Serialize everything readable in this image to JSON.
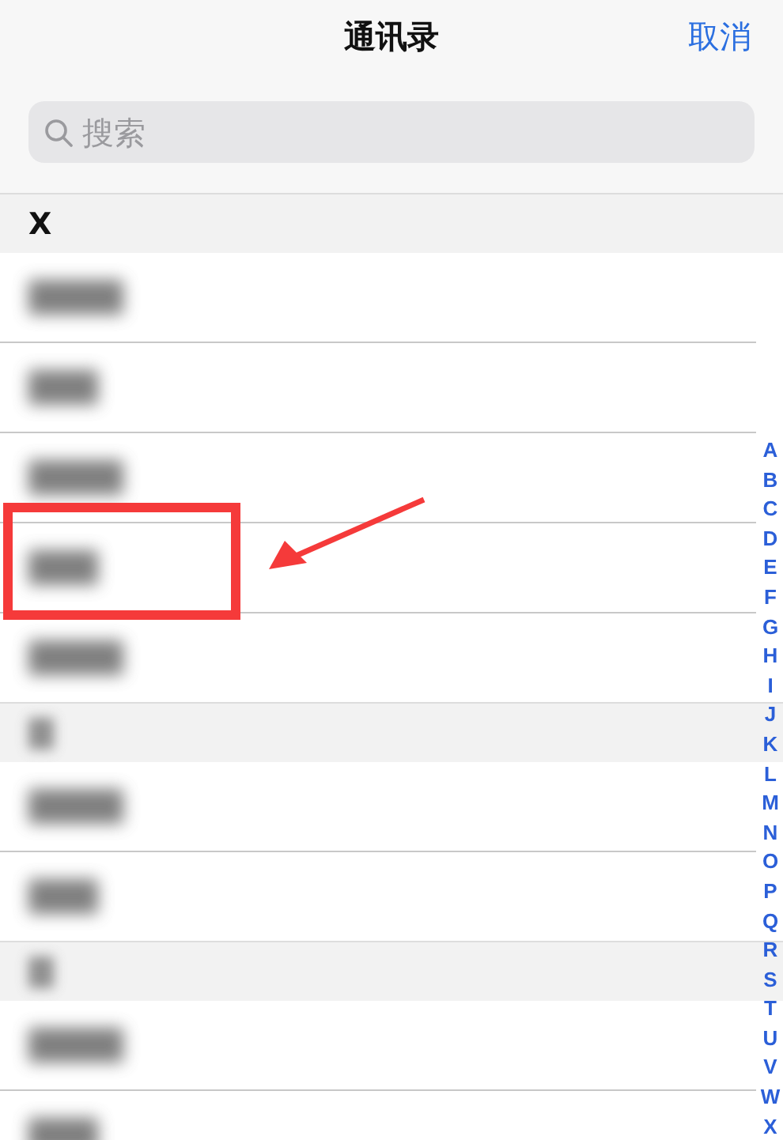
{
  "nav": {
    "title": "通讯录",
    "cancel": "取消"
  },
  "search": {
    "placeholder": "搜索"
  },
  "sections": [
    {
      "kind": "clear",
      "letter": "X",
      "contacts": [
        {
          "kind": "blurred"
        },
        {
          "kind": "blurred"
        },
        {
          "kind": "blurred"
        },
        {
          "kind": "blurred"
        },
        {
          "kind": "blurred"
        }
      ]
    },
    {
      "kind": "blurred",
      "contacts": [
        {
          "kind": "blurred"
        },
        {
          "kind": "blurred"
        }
      ]
    },
    {
      "kind": "blurred",
      "contacts": [
        {
          "kind": "blurred"
        },
        {
          "kind": "blurred"
        }
      ]
    }
  ],
  "index": [
    "A",
    "B",
    "C",
    "D",
    "E",
    "F",
    "G",
    "H",
    "I",
    "J",
    "K",
    "L",
    "M",
    "N",
    "O",
    "P",
    "Q",
    "R",
    "S",
    "T",
    "U",
    "V",
    "W",
    "X"
  ],
  "annotation": {
    "kind": "box-arrow"
  }
}
